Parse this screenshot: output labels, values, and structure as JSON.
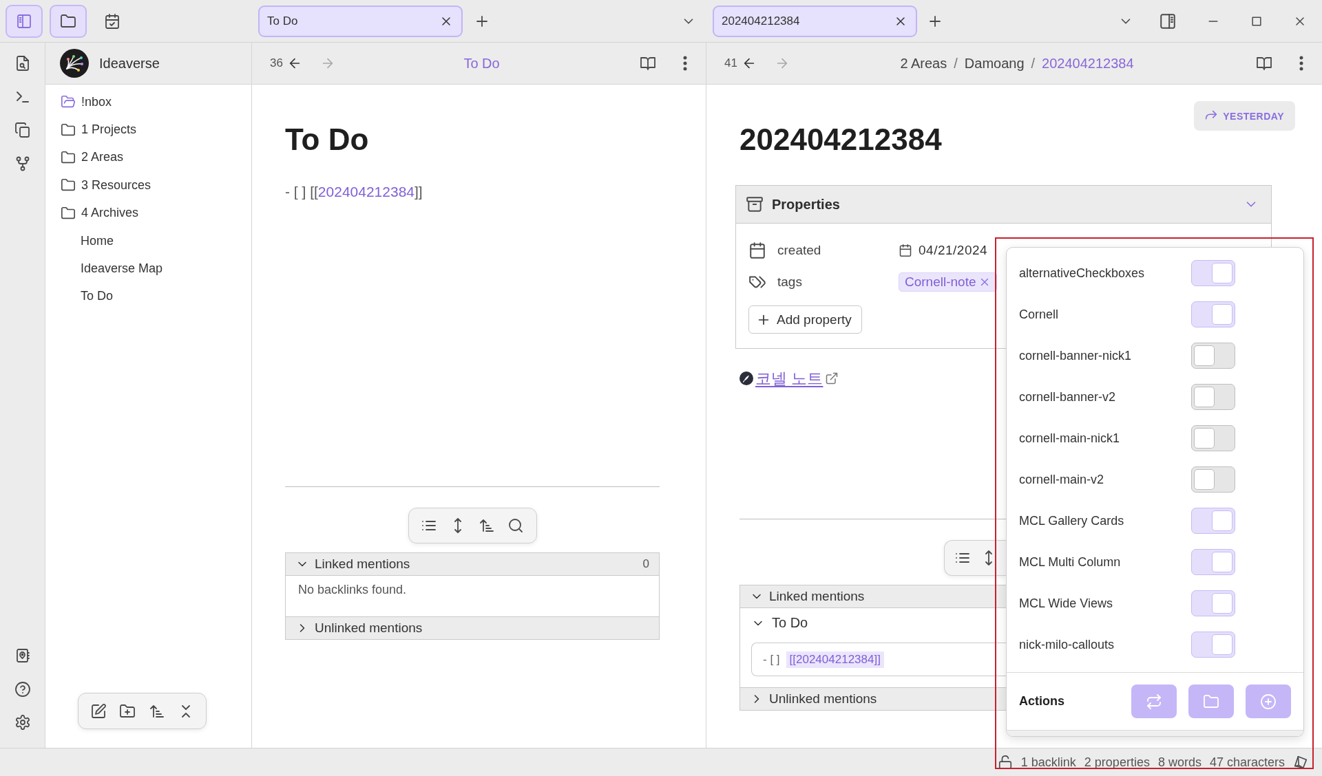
{
  "title_bar": {
    "sidebar_buttons": [
      {
        "selected": true
      },
      {
        "selected": true
      },
      {
        "selected": false
      }
    ],
    "tab_groups": [
      {
        "tabs": [
          {
            "label": "To Do",
            "selected": true
          }
        ]
      },
      {
        "tabs": [
          {
            "label": "202404212384",
            "selected": true
          }
        ]
      }
    ]
  },
  "sidebar": {
    "vault_name": "Ideaverse",
    "items": [
      {
        "kind": "inbox",
        "name": "!nbox"
      },
      {
        "kind": "folder",
        "name": "1 Projects"
      },
      {
        "kind": "folder",
        "name": "2 Areas"
      },
      {
        "kind": "folder",
        "name": "3 Resources"
      },
      {
        "kind": "folder",
        "name": "4 Archives"
      },
      {
        "kind": "note",
        "name": "Home"
      },
      {
        "kind": "note",
        "name": "Ideaverse Map"
      },
      {
        "kind": "note",
        "name": "To Do"
      }
    ]
  },
  "panes": [
    {
      "header": {
        "history_count": "36",
        "back_disabled": false,
        "forward_disabled": true,
        "breadcrumb": [
          {
            "text": "To Do",
            "current": true
          }
        ]
      },
      "heading": "To Do",
      "note_line": {
        "before": "- [ ] [[",
        "link": "202404212384",
        "after": "]]"
      },
      "backlinks": {
        "linked": {
          "label": "Linked mentions",
          "expanded": true,
          "count": "0",
          "empty_text": "No backlinks found."
        },
        "unlinked": {
          "label": "Unlinked mentions",
          "expanded": false
        }
      }
    },
    {
      "header": {
        "history_count": "41",
        "back_disabled": false,
        "forward_disabled": true,
        "separator": "/",
        "breadcrumb": [
          {
            "text": "2 Areas",
            "current": false
          },
          {
            "text": "Damoang",
            "current": false
          },
          {
            "text": "202404212384",
            "current": true
          }
        ]
      },
      "yesterday_button": "YESTERDAY",
      "heading": "202404212384",
      "properties": {
        "title": "Properties",
        "expanded": true,
        "rows": [
          {
            "kind": "date",
            "name": "created",
            "value": "04/21/2024"
          },
          {
            "kind": "tags",
            "name": "tags",
            "tags": [
              "Cornell-note"
            ]
          }
        ],
        "add_label": "Add property"
      },
      "external_link": "코넬 노트",
      "backlinks": {
        "linked": {
          "label": "Linked mentions",
          "expanded": true,
          "results": [
            {
              "file": "To Do",
              "expanded": true,
              "before": "- [ ]",
              "link": "[[202404212384]]"
            }
          ]
        },
        "unlinked": {
          "label": "Unlinked mentions",
          "expanded": false
        }
      }
    }
  ],
  "snippets_popup": {
    "items": [
      {
        "label": "alternativeCheckboxes",
        "on": true
      },
      {
        "label": "Cornell",
        "on": true
      },
      {
        "label": "cornell-banner-nick1",
        "on": false
      },
      {
        "label": "cornell-banner-v2",
        "on": false
      },
      {
        "label": "cornell-main-nick1",
        "on": false
      },
      {
        "label": "cornell-main-v2",
        "on": false
      },
      {
        "label": "MCL Gallery Cards",
        "on": true
      },
      {
        "label": "MCL Multi Column",
        "on": true
      },
      {
        "label": "MCL Wide Views",
        "on": true
      },
      {
        "label": "nick-milo-callouts",
        "on": true
      }
    ],
    "actions_label": "Actions"
  },
  "status_bar": {
    "items": [
      "1 backlink",
      "2 properties",
      "8 words",
      "47 characters"
    ]
  }
}
